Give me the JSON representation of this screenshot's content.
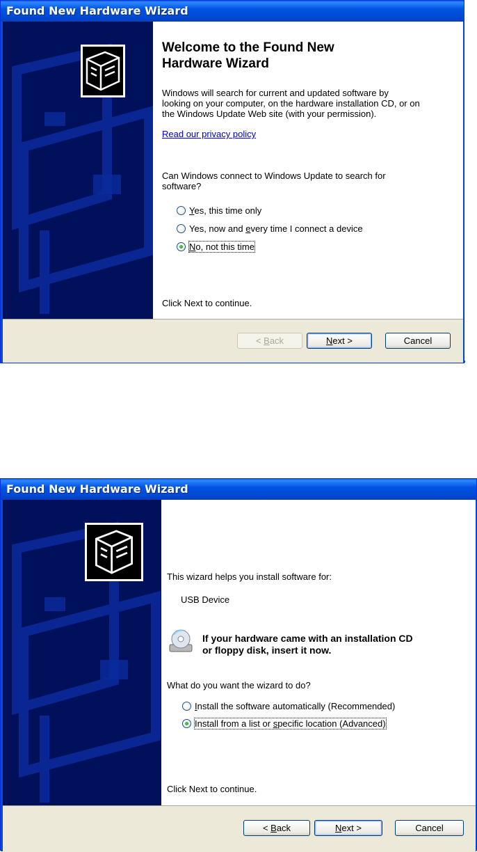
{
  "wizard1": {
    "title": "Found New Hardware Wizard",
    "heading_line1": "Welcome to the Found New",
    "heading_line2": "Hardware Wizard",
    "desc_line1": "Windows will search for current and updated software by",
    "desc_line2": "looking on your computer, on the hardware installation CD, or on",
    "desc_line3": "the Windows Update Web site (with your permission).",
    "privacy_link": "Read our privacy policy",
    "question_line1": "Can Windows connect to Windows Update to search for",
    "question_line2": "software?",
    "options": [
      {
        "pre": "",
        "key": "Y",
        "post": "es, this time only",
        "checked": false
      },
      {
        "pre": "Yes, now and ",
        "key": "e",
        "post": "very time I connect a device",
        "checked": false
      },
      {
        "pre": "",
        "key": "N",
        "post": "o, not this time",
        "checked": true
      }
    ],
    "continue_text": "Click Next to continue.",
    "back_key": "B",
    "back_rest": "ack",
    "back_pre": "< ",
    "next_key": "N",
    "next_rest": "ext >",
    "cancel_label": "Cancel"
  },
  "wizard2": {
    "title": "Found New Hardware Wizard",
    "intro": "This wizard helps you install software for:",
    "device": "USB Device",
    "cd_line1": "If your hardware came with an installation CD",
    "cd_line2": "or floppy disk, insert it now.",
    "question": "What do you want the wizard to do?",
    "options": [
      {
        "pre": "",
        "key": "I",
        "post": "nstall the software automatically (Recommended)",
        "checked": false
      },
      {
        "pre": "Install from a list or ",
        "key": "s",
        "post": "pecific location (Advanced)",
        "checked": true
      }
    ],
    "continue_text": "Click Next to continue.",
    "back_key": "B",
    "back_rest": "ack",
    "back_pre": "< ",
    "next_key": "N",
    "next_rest": "ext >",
    "cancel_label": "Cancel"
  }
}
